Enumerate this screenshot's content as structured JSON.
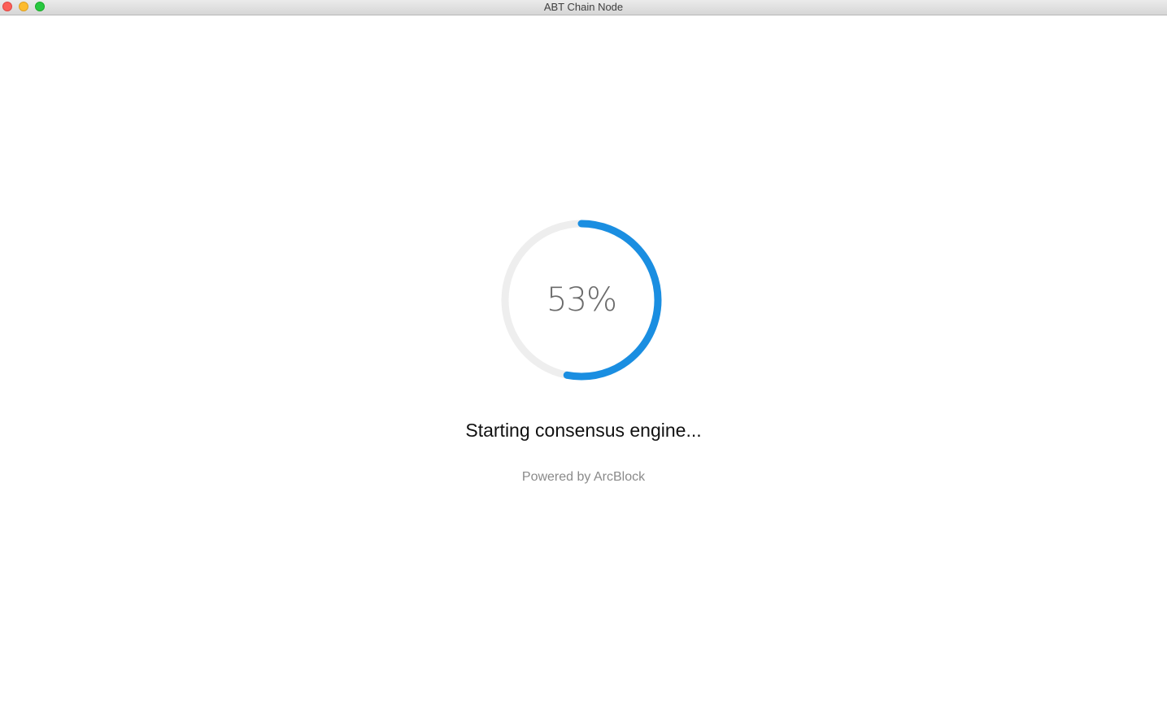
{
  "window": {
    "title": "ABT Chain Node"
  },
  "progress": {
    "percent": 53,
    "label": "53%",
    "track_color": "#eeeeee",
    "fill_color": "#1a8ee1"
  },
  "status": {
    "message": "Starting consensus engine..."
  },
  "footer": {
    "powered_by": "Powered by ArcBlock"
  }
}
